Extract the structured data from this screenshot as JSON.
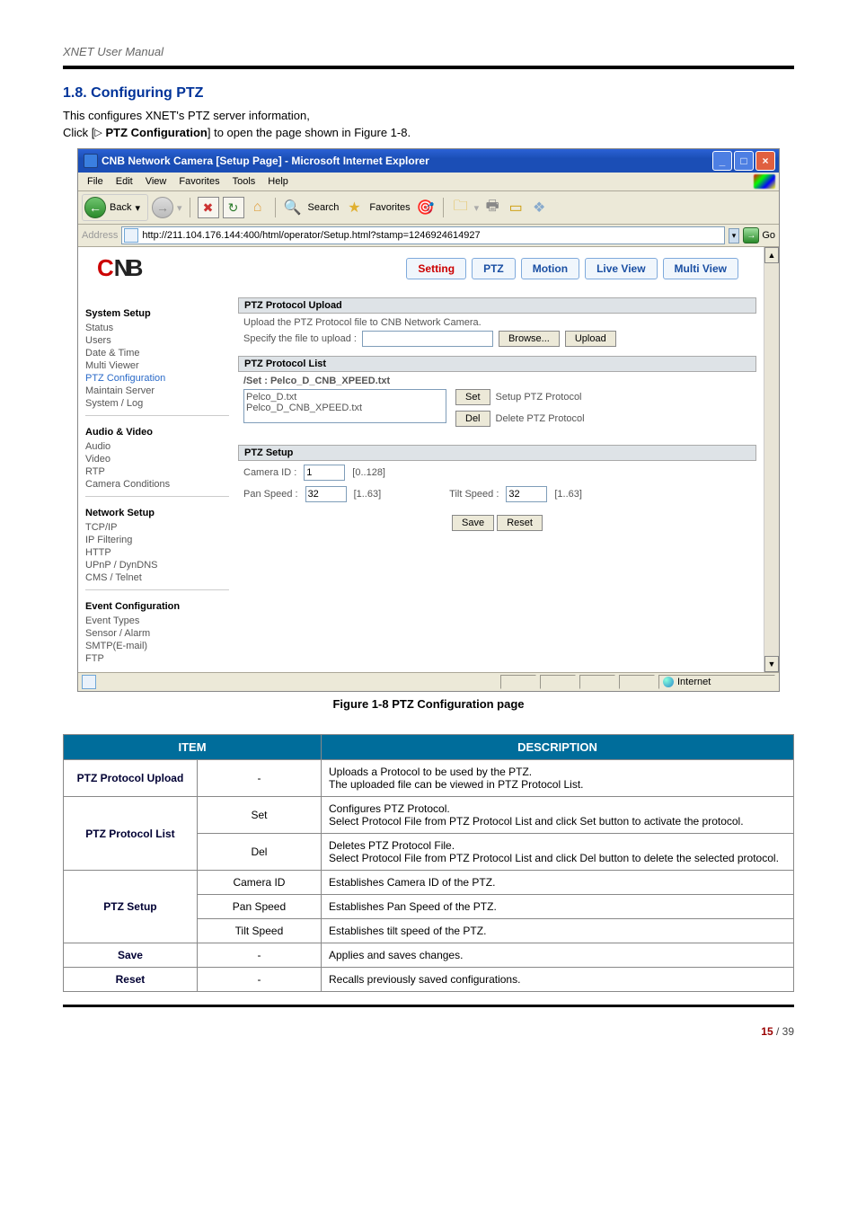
{
  "manual_title": "XNET User Manual",
  "section_number": "1.8. Configuring PTZ",
  "intro_line": "This configures XNET's PTZ server information,",
  "click_prefix": "Click [",
  "click_linktext": "PTZ Configuration",
  "click_suffix": "] to open the page shown in Figure 1-8.",
  "figure_caption": "Figure 1-8 PTZ Configuration page",
  "ie": {
    "title": "CNB Network Camera [Setup Page] - Microsoft Internet Explorer",
    "menus": [
      "File",
      "Edit",
      "View",
      "Favorites",
      "Tools",
      "Help"
    ],
    "toolbar": {
      "back": "Back",
      "search": "Search",
      "favorites": "Favorites"
    },
    "address_label": "Address",
    "url": "http://211.104.176.144:400/html/operator/Setup.html?stamp=1246924614927",
    "go": "Go",
    "status_zone": "Internet",
    "tabs": {
      "setting": "Setting",
      "ptz": "PTZ",
      "motion": "Motion",
      "live": "Live View",
      "multi": "Multi View"
    },
    "sidebar": {
      "g1": "System Setup",
      "g1_items": [
        "Status",
        "Users",
        "Date & Time",
        "Multi Viewer",
        "PTZ Configuration",
        "Maintain Server",
        "System / Log"
      ],
      "g2": "Audio & Video",
      "g2_items": [
        "Audio",
        "Video",
        "RTP",
        "Camera Conditions"
      ],
      "g3": "Network Setup",
      "g3_items": [
        "TCP/IP",
        "IP Filtering",
        "HTTP",
        "UPnP / DynDNS",
        "CMS / Telnet"
      ],
      "g4": "Event Configuration",
      "g4_items": [
        "Event Types",
        "Sensor / Alarm",
        "SMTP(E-mail)",
        "FTP"
      ]
    },
    "panels": {
      "upload_head": "PTZ Protocol Upload",
      "upload_desc": "Upload the PTZ Protocol file to CNB Network Camera.",
      "upload_label": "Specify the file to upload :",
      "browse": "Browse...",
      "upload_btn": "Upload",
      "list_head": "PTZ Protocol List",
      "list_set_line": "/Set : Pelco_D_CNB_XPEED.txt",
      "list_opt1": "Pelco_D.txt",
      "list_opt2": "Pelco_D_CNB_XPEED.txt",
      "set_btn": "Set",
      "set_hint": "Setup PTZ Protocol",
      "del_btn": "Del",
      "del_hint": "Delete PTZ Protocol",
      "setup_head": "PTZ Setup",
      "camera_id_label": "Camera ID :",
      "camera_id_val": "1",
      "camera_id_range": "[0..128]",
      "pan_label": "Pan Speed :",
      "pan_val": "32",
      "pan_range": "[1..63]",
      "tilt_label": "Tilt Speed :",
      "tilt_val": "32",
      "tilt_range": "[1..63]",
      "save": "Save",
      "reset": "Reset"
    }
  },
  "table": {
    "head_item": "ITEM",
    "head_desc": "DESCRIPTION",
    "rows": {
      "upload_label": "PTZ Protocol Upload",
      "upload_sub": "-",
      "upload_desc": "Uploads a Protocol to be used by the PTZ.\nThe uploaded file can be viewed in PTZ Protocol List.",
      "list_label": "PTZ Protocol List",
      "list_set": "Set",
      "list_set_desc": "Configures PTZ Protocol.\nSelect Protocol File from PTZ Protocol List and click Set button to activate the protocol.",
      "list_del": "Del",
      "list_del_desc": "Deletes PTZ Protocol File.\nSelect Protocol File from PTZ Protocol List and click Del button to delete the selected protocol.",
      "setup_label": "PTZ Setup",
      "setup_cam": "Camera ID",
      "setup_cam_desc": "Establishes Camera ID of the PTZ.",
      "setup_pan": "Pan Speed",
      "setup_pan_desc": "Establishes Pan Speed of the PTZ.",
      "setup_tilt": "Tilt Speed",
      "setup_tilt_desc": "Establishes tilt speed of the PTZ.",
      "save_label": "Save",
      "save_sub": "-",
      "save_desc": "Applies and saves changes.",
      "reset_label": "Reset",
      "reset_sub": "-",
      "reset_desc": "Recalls previously saved configurations."
    }
  },
  "footer": {
    "page_current": "15",
    "page_sep": " / ",
    "page_total": "39"
  }
}
